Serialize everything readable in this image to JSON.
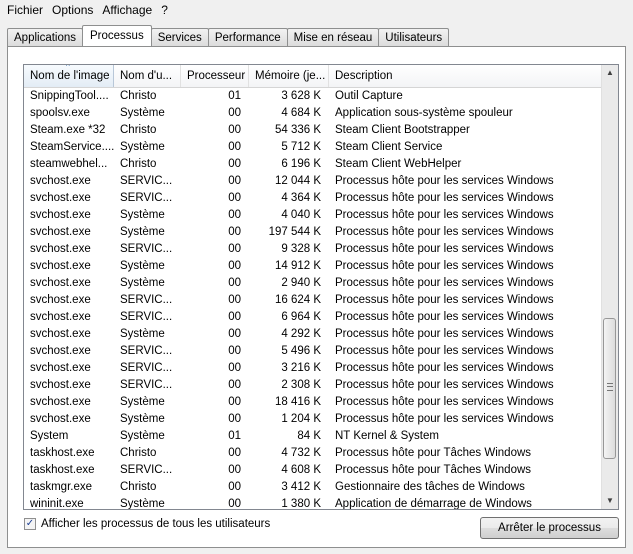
{
  "menu": [
    "Fichier",
    "Options",
    "Affichage",
    "?"
  ],
  "tabs": [
    "Applications",
    "Processus",
    "Services",
    "Performance",
    "Mise en réseau",
    "Utilisateurs"
  ],
  "active_tab": "Processus",
  "columns": [
    "Nom de l'image",
    "Nom d'u...",
    "Processeur",
    "Mémoire (je...",
    "Description"
  ],
  "rows": [
    {
      "name": "SnippingTool....",
      "user": "Christo",
      "cpu": "01",
      "mem": "3 628 K",
      "desc": "Outil Capture"
    },
    {
      "name": "spoolsv.exe",
      "user": "Système",
      "cpu": "00",
      "mem": "4 684 K",
      "desc": "Application sous-système spouleur"
    },
    {
      "name": "Steam.exe *32",
      "user": "Christo",
      "cpu": "00",
      "mem": "54 336 K",
      "desc": "Steam Client Bootstrapper"
    },
    {
      "name": "SteamService....",
      "user": "Système",
      "cpu": "00",
      "mem": "5 712 K",
      "desc": "Steam Client Service"
    },
    {
      "name": "steamwebhel...",
      "user": "Christo",
      "cpu": "00",
      "mem": "6 196 K",
      "desc": "Steam Client WebHelper"
    },
    {
      "name": "svchost.exe",
      "user": "SERVIC...",
      "cpu": "00",
      "mem": "12 044 K",
      "desc": "Processus hôte pour les services Windows"
    },
    {
      "name": "svchost.exe",
      "user": "SERVIC...",
      "cpu": "00",
      "mem": "4 364 K",
      "desc": "Processus hôte pour les services Windows"
    },
    {
      "name": "svchost.exe",
      "user": "Système",
      "cpu": "00",
      "mem": "4 040 K",
      "desc": "Processus hôte pour les services Windows"
    },
    {
      "name": "svchost.exe",
      "user": "Système",
      "cpu": "00",
      "mem": "197 544 K",
      "desc": "Processus hôte pour les services Windows"
    },
    {
      "name": "svchost.exe",
      "user": "SERVIC...",
      "cpu": "00",
      "mem": "9 328 K",
      "desc": "Processus hôte pour les services Windows"
    },
    {
      "name": "svchost.exe",
      "user": "Système",
      "cpu": "00",
      "mem": "14 912 K",
      "desc": "Processus hôte pour les services Windows"
    },
    {
      "name": "svchost.exe",
      "user": "Système",
      "cpu": "00",
      "mem": "2 940 K",
      "desc": "Processus hôte pour les services Windows"
    },
    {
      "name": "svchost.exe",
      "user": "SERVIC...",
      "cpu": "00",
      "mem": "16 624 K",
      "desc": "Processus hôte pour les services Windows"
    },
    {
      "name": "svchost.exe",
      "user": "SERVIC...",
      "cpu": "00",
      "mem": "6 964 K",
      "desc": "Processus hôte pour les services Windows"
    },
    {
      "name": "svchost.exe",
      "user": "Système",
      "cpu": "00",
      "mem": "4 292 K",
      "desc": "Processus hôte pour les services Windows"
    },
    {
      "name": "svchost.exe",
      "user": "SERVIC...",
      "cpu": "00",
      "mem": "5 496 K",
      "desc": "Processus hôte pour les services Windows"
    },
    {
      "name": "svchost.exe",
      "user": "SERVIC...",
      "cpu": "00",
      "mem": "3 216 K",
      "desc": "Processus hôte pour les services Windows"
    },
    {
      "name": "svchost.exe",
      "user": "SERVIC...",
      "cpu": "00",
      "mem": "2 308 K",
      "desc": "Processus hôte pour les services Windows"
    },
    {
      "name": "svchost.exe",
      "user": "Système",
      "cpu": "00",
      "mem": "18 416 K",
      "desc": "Processus hôte pour les services Windows"
    },
    {
      "name": "svchost.exe",
      "user": "Système",
      "cpu": "00",
      "mem": "1 204 K",
      "desc": "Processus hôte pour les services Windows"
    },
    {
      "name": "System",
      "user": "Système",
      "cpu": "01",
      "mem": "84 K",
      "desc": "NT Kernel & System"
    },
    {
      "name": "taskhost.exe",
      "user": "Christo",
      "cpu": "00",
      "mem": "4 732 K",
      "desc": "Processus hôte pour Tâches Windows"
    },
    {
      "name": "taskhost.exe",
      "user": "SERVIC...",
      "cpu": "00",
      "mem": "4 608 K",
      "desc": "Processus hôte pour Tâches Windows"
    },
    {
      "name": "taskmgr.exe",
      "user": "Christo",
      "cpu": "00",
      "mem": "3 412 K",
      "desc": "Gestionnaire des tâches de Windows"
    },
    {
      "name": "wininit.exe",
      "user": "Système",
      "cpu": "00",
      "mem": "1 380 K",
      "desc": "Application de démarrage de Windows"
    }
  ],
  "show_all_label": "Afficher les processus de tous les utilisateurs",
  "show_all_checked": "✓",
  "end_process_label": "Arrêter le processus",
  "icons": {
    "sort": "sort-up-icon",
    "scroll_up": "▲",
    "scroll_down": "▼"
  }
}
